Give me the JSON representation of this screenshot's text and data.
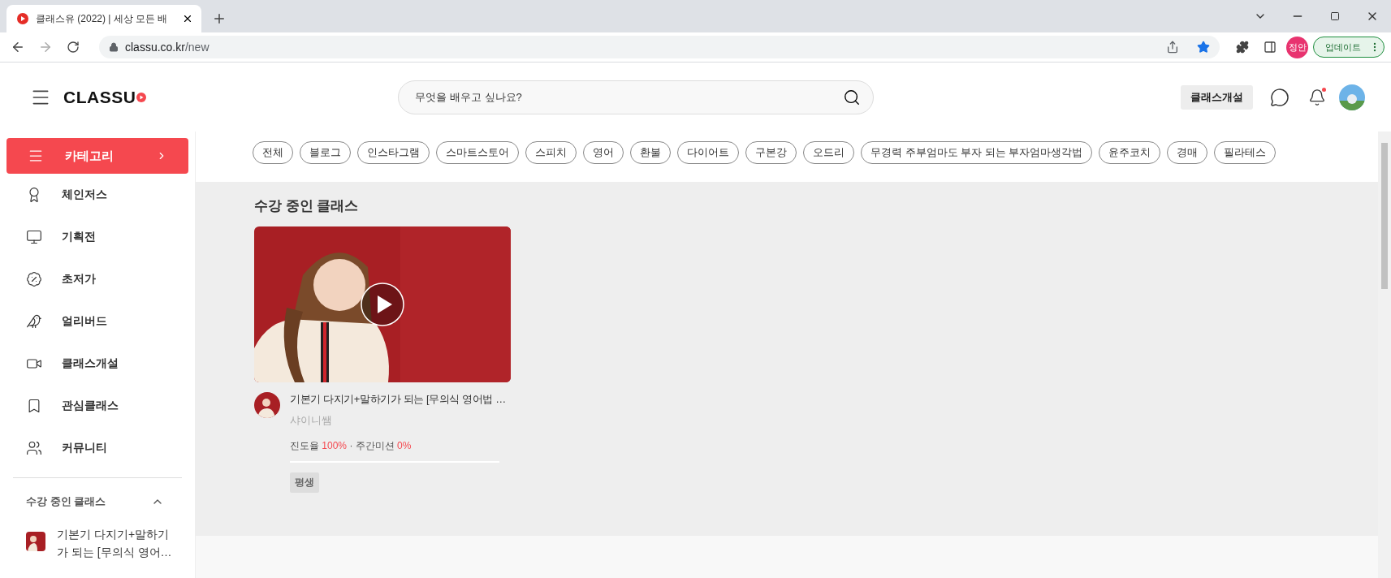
{
  "browser": {
    "tab": {
      "title": "클래스유 (2022) | 세상 모든 배"
    },
    "url": {
      "host": "classu.co.kr",
      "path": "/new"
    },
    "bookmarked": true,
    "profile": "정안",
    "update_button": "업데이트"
  },
  "header": {
    "logo": "CLASSU",
    "search": {
      "placeholder": "무엇을 배우고 싶나요?"
    },
    "open_class_button": "클래스개설",
    "has_new_notification": true
  },
  "sidebar": {
    "category_button": "카테고리",
    "items": [
      {
        "label": "체인저스",
        "kind": "badge"
      },
      {
        "label": "기획전",
        "kind": "screen"
      },
      {
        "label": "초저가",
        "kind": "discount"
      },
      {
        "label": "얼리버드",
        "kind": "bird"
      },
      {
        "label": "클래스개설",
        "kind": "video"
      },
      {
        "label": "관심클래스",
        "kind": "bookmark"
      },
      {
        "label": "커뮤니티",
        "kind": "people"
      }
    ],
    "enrolled": {
      "title": "수강 중인 클래스",
      "expanded": true,
      "items": [
        {
          "title": "기본기 다지기+말하기가 되는 [무의식 영어…"
        }
      ]
    }
  },
  "categories": [
    "전체",
    "블로그",
    "인스타그램",
    "스마트스토어",
    "스피치",
    "영어",
    "환불",
    "다이어트",
    "구본강",
    "오드리",
    "무경력 주부엄마도 부자 되는 부자엄마생각법",
    "윤주코치",
    "경매",
    "필라테스"
  ],
  "enrolled_section": {
    "title": "수강 중인 클래스",
    "cards": [
      {
        "title": "기본기 다지기+말하기가 되는 [무의식 영어법 …",
        "teacher": "샤이니쌤",
        "progress_label": "진도율",
        "progress": "100%",
        "separator": "·",
        "mission_label": "주간미션",
        "mission": "0%",
        "tag": "평생"
      }
    ]
  }
}
